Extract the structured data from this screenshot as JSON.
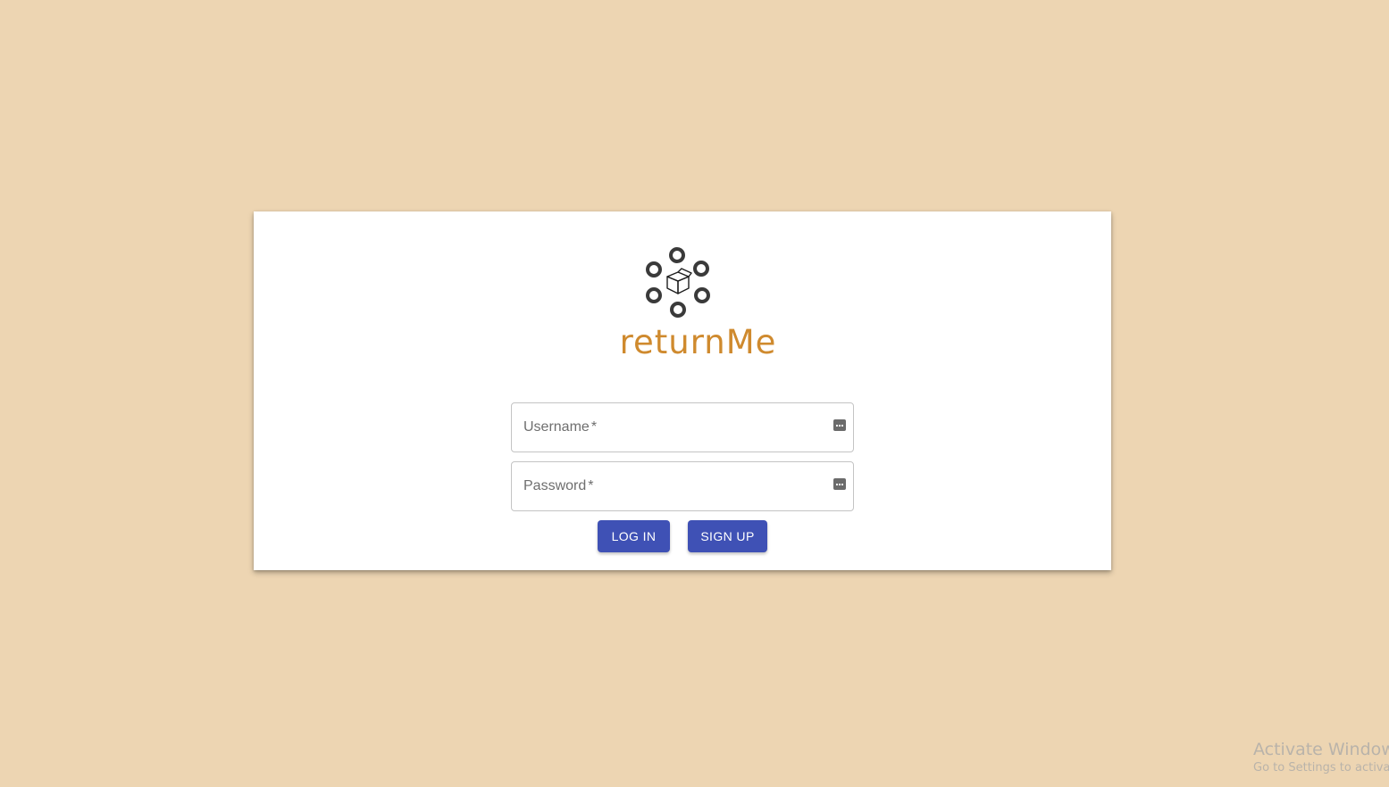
{
  "colors": {
    "background": "#EDD5B2",
    "card": "#FFFFFF",
    "brand": "#CF8A2E",
    "button": "#3F51B5",
    "logo": "#3A3A3A"
  },
  "logo": {
    "icon": "logo-rings-box-icon",
    "name": "returnMe"
  },
  "form": {
    "username": {
      "label": "Username",
      "required_mark": "*",
      "value": "",
      "icon": "password-manager-key-icon"
    },
    "password": {
      "label": "Password",
      "required_mark": "*",
      "value": "",
      "icon": "password-manager-key-icon"
    }
  },
  "buttons": {
    "login_label": "LOG IN",
    "signup_label": "SIGN UP"
  },
  "watermark": {
    "title": "Activate Windows",
    "subtitle": "Go to Settings to activate Windows."
  }
}
